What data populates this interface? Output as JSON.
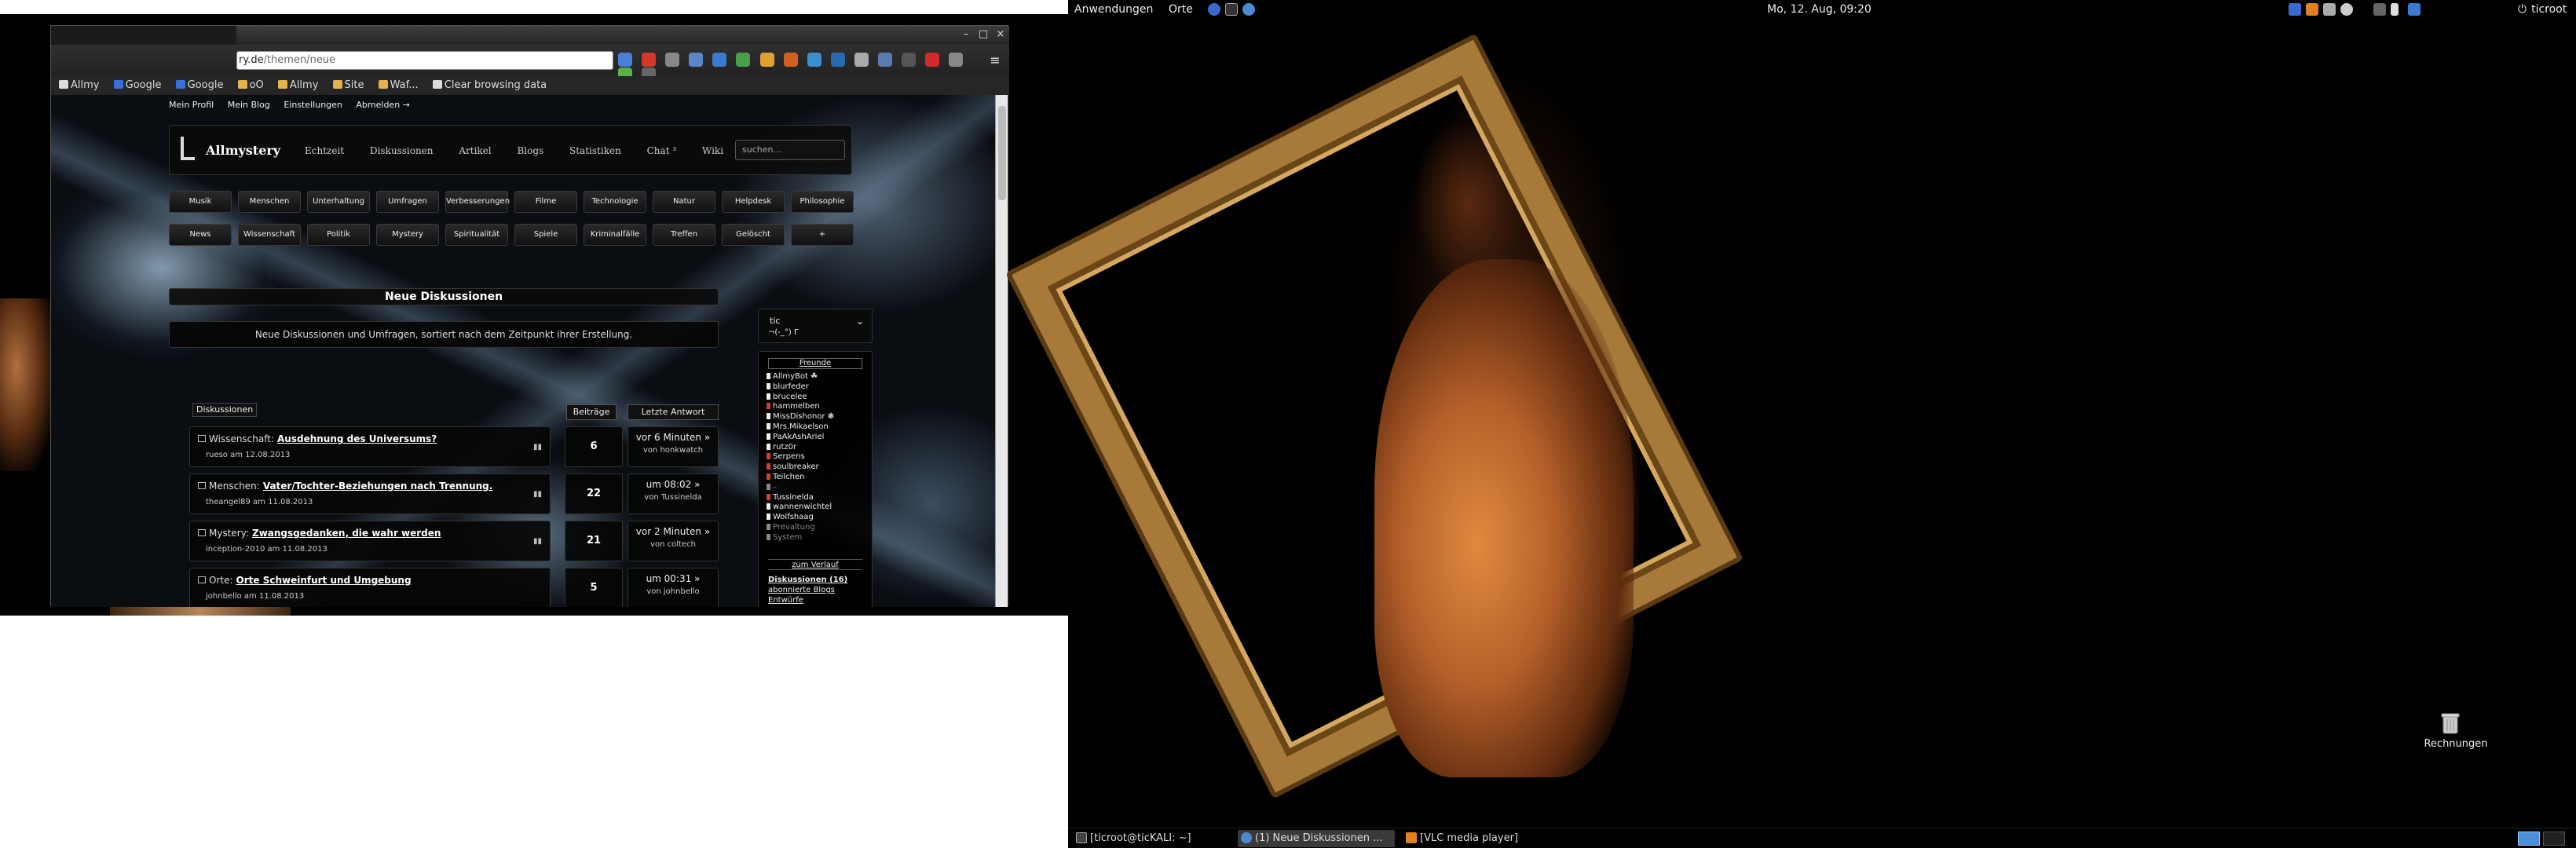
{
  "browser": {
    "url_host_partial": "ry.de",
    "url_path": "/themen/neue",
    "window_controls": [
      "–",
      "□",
      "×"
    ],
    "menu_icon": "hamburger-menu-icon",
    "bookmarks": [
      "Allmy",
      "Google",
      "Google",
      "oO",
      "Allmy",
      "Site",
      "Waf...",
      "Clear browsing data"
    ]
  },
  "site": {
    "top_nav": [
      "Mein Profil",
      "Mein Blog",
      "Einstellungen",
      "Abmelden →"
    ],
    "logo_text": "Allmystery",
    "main_nav": [
      "Echtzeit",
      "Diskussionen",
      "Artikel",
      "Blogs",
      "Statistiken",
      "Chat ³",
      "Wiki"
    ],
    "search_placeholder": "suchen...",
    "categories_row1": [
      "Musik",
      "Menschen",
      "Unterhaltung",
      "Umfragen",
      "Verbesserungen",
      "Filme",
      "Technologie",
      "Natur",
      "Helpdesk",
      "Philosophie"
    ],
    "categories_row2": [
      "News",
      "Wissenschaft",
      "Politik",
      "Mystery",
      "Spiritualität",
      "Spiele",
      "Kriminalfälle",
      "Treffen",
      "Gelöscht",
      "+"
    ],
    "section_title": "Neue Diskussionen",
    "section_description": "Neue Diskussionen und Umfragen, sortiert nach dem Zeitpunkt ihrer Erstellung.",
    "tab_label": "Diskussionen",
    "col_posts": "Beiträge",
    "col_last": "Letzte Antwort",
    "threads": [
      {
        "category": "Wissenschaft:",
        "title": "Ausdehnung des Universums?",
        "meta": "rueso am 12.08.2013",
        "posts": "6",
        "last_when": "vor 6 Minuten »",
        "last_by": "von honkwatch"
      },
      {
        "category": "Menschen:",
        "title": "Vater/Tochter-Beziehungen nach Trennung.",
        "meta": "theangel89 am 11.08.2013",
        "posts": "22",
        "last_when": "um 08:02 »",
        "last_by": "von Tussinelda"
      },
      {
        "category": "Mystery:",
        "title": "Zwangsgedanken, die wahr werden",
        "meta": "inception-2010 am 11.08.2013",
        "posts": "21",
        "last_when": "vor 2 Minuten »",
        "last_by": "von coltech"
      },
      {
        "category": "Orte:",
        "title": "Orte Schweinfurt und Umgebung",
        "meta": "johnbello am 11.08.2013",
        "posts": "5",
        "last_when": "um 00:31 »",
        "last_by": "von johnbello"
      }
    ],
    "user_panel": {
      "username": "tic",
      "status": "¬(-_°) Γ"
    },
    "friends_header": "Freunde",
    "friends": [
      {
        "name": "AllmyBot ☘",
        "status": "white"
      },
      {
        "name": "blurfeder",
        "status": "white"
      },
      {
        "name": "brucelee",
        "status": "white"
      },
      {
        "name": "hammelben",
        "status": "red"
      },
      {
        "name": "MissDishonor ❃",
        "status": "white"
      },
      {
        "name": "Mrs.Mikaelson",
        "status": "white"
      },
      {
        "name": "PaAkAshAriel",
        "status": "white"
      },
      {
        "name": "rutz0r",
        "status": "white"
      },
      {
        "name": "Serpens",
        "status": "red"
      },
      {
        "name": "soulbreaker",
        "status": "red"
      },
      {
        "name": "Teilchen",
        "status": "red"
      },
      {
        "name": "–",
        "status": "gray"
      },
      {
        "name": "Tussinelda",
        "status": "red"
      },
      {
        "name": "wannenwichtel",
        "status": "white"
      },
      {
        "name": "Wolfshaag",
        "status": "white"
      },
      {
        "name": "Prevaltung",
        "status": "gray"
      },
      {
        "name": "System",
        "status": "gray"
      }
    ],
    "verlauf_link": "zum Verlauf",
    "links": {
      "diskussionen": "Diskussionen (16)",
      "abonnierte": "abonnierte Blogs",
      "entwuerfe": "Entwürfe"
    }
  },
  "gnome": {
    "applications": "Anwendungen",
    "places": "Orte",
    "clock": "Mo, 12. Aug, 09:20",
    "user": "ticroot",
    "desktop_icon_label": "Rechnungen",
    "taskbar": [
      "[ticroot@ticKALI: ~]",
      "(1) Neue Diskussionen ...",
      "[VLC media player]"
    ]
  },
  "colors": {
    "site_bg": "#0a0d12",
    "panel_bg": "#000000",
    "accent_red": "#d04030",
    "workspace_active": "#4a90d9"
  }
}
